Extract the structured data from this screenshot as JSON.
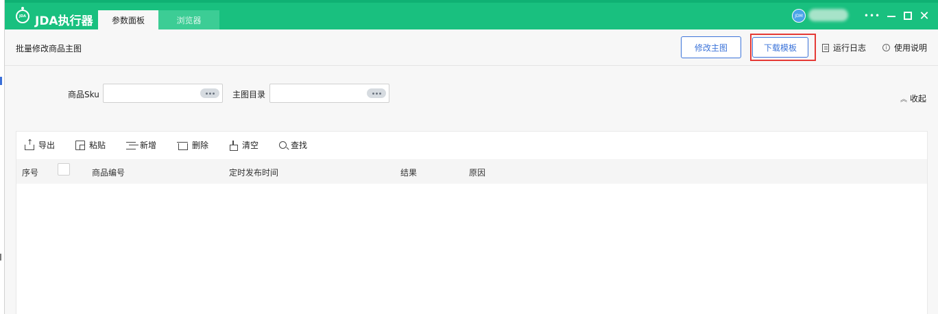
{
  "app": {
    "title": "JDA执行器",
    "logo_text": "JDA",
    "tabs": [
      {
        "label": "参数面板",
        "active": true
      },
      {
        "label": "浏览器",
        "active": false
      }
    ],
    "user": {
      "avatar_text": "JDM"
    },
    "window_controls": {
      "more": "•••",
      "close": "✕"
    }
  },
  "header": {
    "page_title": "批量修改商品主图",
    "buttons": {
      "modify": "修改主图",
      "download_template": "下载模板"
    },
    "links": {
      "run_log": "运行日志",
      "help": "使用说明"
    }
  },
  "search": {
    "sku_label": "商品Sku",
    "sku_value": "",
    "dir_label": "主图目录",
    "dir_value": "",
    "collapse_label": "收起"
  },
  "toolbar": {
    "export": "导出",
    "paste": "粘贴",
    "add": "新增",
    "delete": "删除",
    "clear": "清空",
    "find": "查找"
  },
  "table": {
    "columns": [
      "序号",
      "商品编号",
      "定时发布时间",
      "结果",
      "原因"
    ],
    "rows": []
  },
  "colors": {
    "titlebar": "#19c07f",
    "accent": "#3b73d9",
    "highlight": "#e53935"
  }
}
